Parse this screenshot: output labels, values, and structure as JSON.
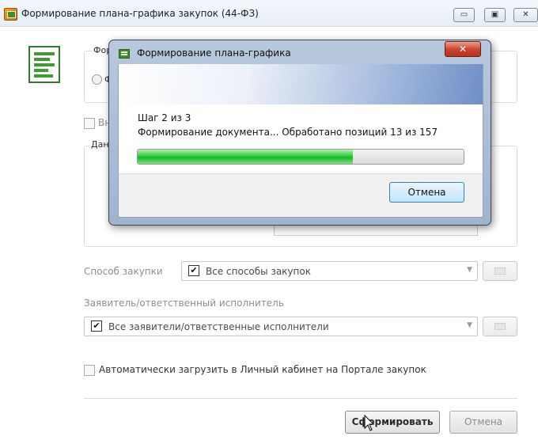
{
  "window": {
    "title": "Формирование плана-графика закупок (44-ФЗ)",
    "min_glyph": "▭",
    "max_glyph": "▣",
    "close_glyph": "✕"
  },
  "main": {
    "group1_label": "Форм",
    "radio_label": "Ф",
    "checkbox_top_label": "Вне",
    "group2_label": "Дан",
    "procurement_method_label": "Способ закупки",
    "procurement_method_value": "Все способы закупок",
    "applicant_label": "Заявитель/ответственный исполнитель",
    "applicant_value": "Все заявители/ответственные исполнители",
    "autoload_label": "Автоматически загрузить в Личный кабинет на Портале закупок",
    "form_button": "Сформировать",
    "cancel_button": "Отмена"
  },
  "dialog": {
    "title": "Формирование плана-графика",
    "close_glyph": "✕",
    "step": "Шаг 2 из 3",
    "status": "Формирование документа... Обработано позиций 13 из 157",
    "progress_fraction": 0.66,
    "cancel_button": "Отмена"
  },
  "icons": {
    "app": "plan-schedule-app-icon",
    "document": "document-list-icon",
    "dialog": "dialog-app-icon",
    "dropdown": "chevron-down-icon",
    "cursor": "mouse-pointer-icon"
  }
}
